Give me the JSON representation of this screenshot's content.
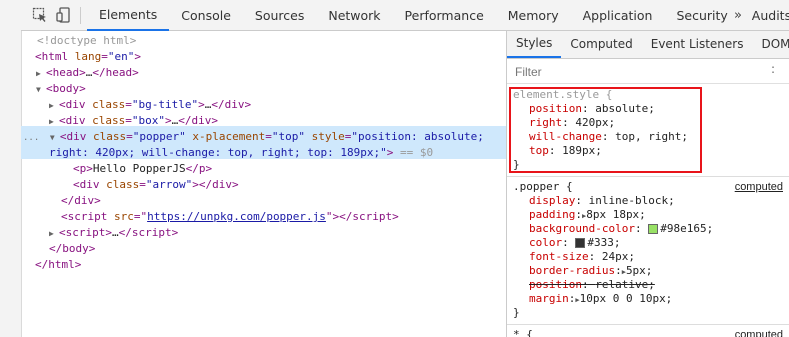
{
  "toolbar": {
    "tabs": [
      "Elements",
      "Console",
      "Sources",
      "Network",
      "Performance",
      "Memory",
      "Application",
      "Security",
      "Audits"
    ],
    "more": "»"
  },
  "dom": {
    "doctype": "<!doctype html>",
    "html_open_tag": "html",
    "html_attr": "lang",
    "html_attr_val": "\"en\"",
    "head": "head",
    "body": "body",
    "div1_class": "\"bg-title\"",
    "div2_class": "\"box\"",
    "popper_class": "\"popper\"",
    "popper_xplacement_attr": "x-placement",
    "popper_xplacement": "\"top\"",
    "popper_style_start": "\"position: absolute;",
    "popper_style_end": "right: 420px; will-change: top, right; top: 189px;\"",
    "popper_marker": "== $0",
    "p_text": "Hello PopperJS",
    "arrow_class": "\"arrow\"",
    "script_src": "https://unpkg.com/popper.js",
    "ellipsis": "…",
    "dots": "..."
  },
  "styles": {
    "tabs": [
      "Styles",
      "Computed",
      "Event Listeners",
      "DOM Bre"
    ],
    "filter_placeholder": "Filter",
    "filter_dots": ":",
    "element_style": {
      "selector": "element.style {",
      "props": [
        {
          "name": "position",
          "value": "absolute;"
        },
        {
          "name": "right",
          "value": "420px;"
        },
        {
          "name": "will-change",
          "value": "top, right;"
        },
        {
          "name": "top",
          "value": "189px;"
        }
      ],
      "close": "}"
    },
    "popper_rule": {
      "selector": ".popper {",
      "source": "computed",
      "props": [
        {
          "name": "display",
          "value": "inline-block;"
        },
        {
          "name": "padding",
          "value": "8px 18px;"
        },
        {
          "name": "background-color",
          "value": "#98e165;"
        },
        {
          "name": "color",
          "value": "#333;"
        },
        {
          "name": "font-size",
          "value": "24px;"
        },
        {
          "name": "border-radius",
          "value": "5px;"
        },
        {
          "name": "position",
          "value": "relative;"
        },
        {
          "name": "margin",
          "value": "10px 0 0 10px;"
        }
      ],
      "close": "}"
    },
    "star_rule": {
      "selector": "* {",
      "source": "computed"
    },
    "colors": {
      "bg_swatch": "#98e165",
      "color_swatch": "#333333",
      "highlight": "#e8141a",
      "accent": "#1a73e8"
    }
  }
}
